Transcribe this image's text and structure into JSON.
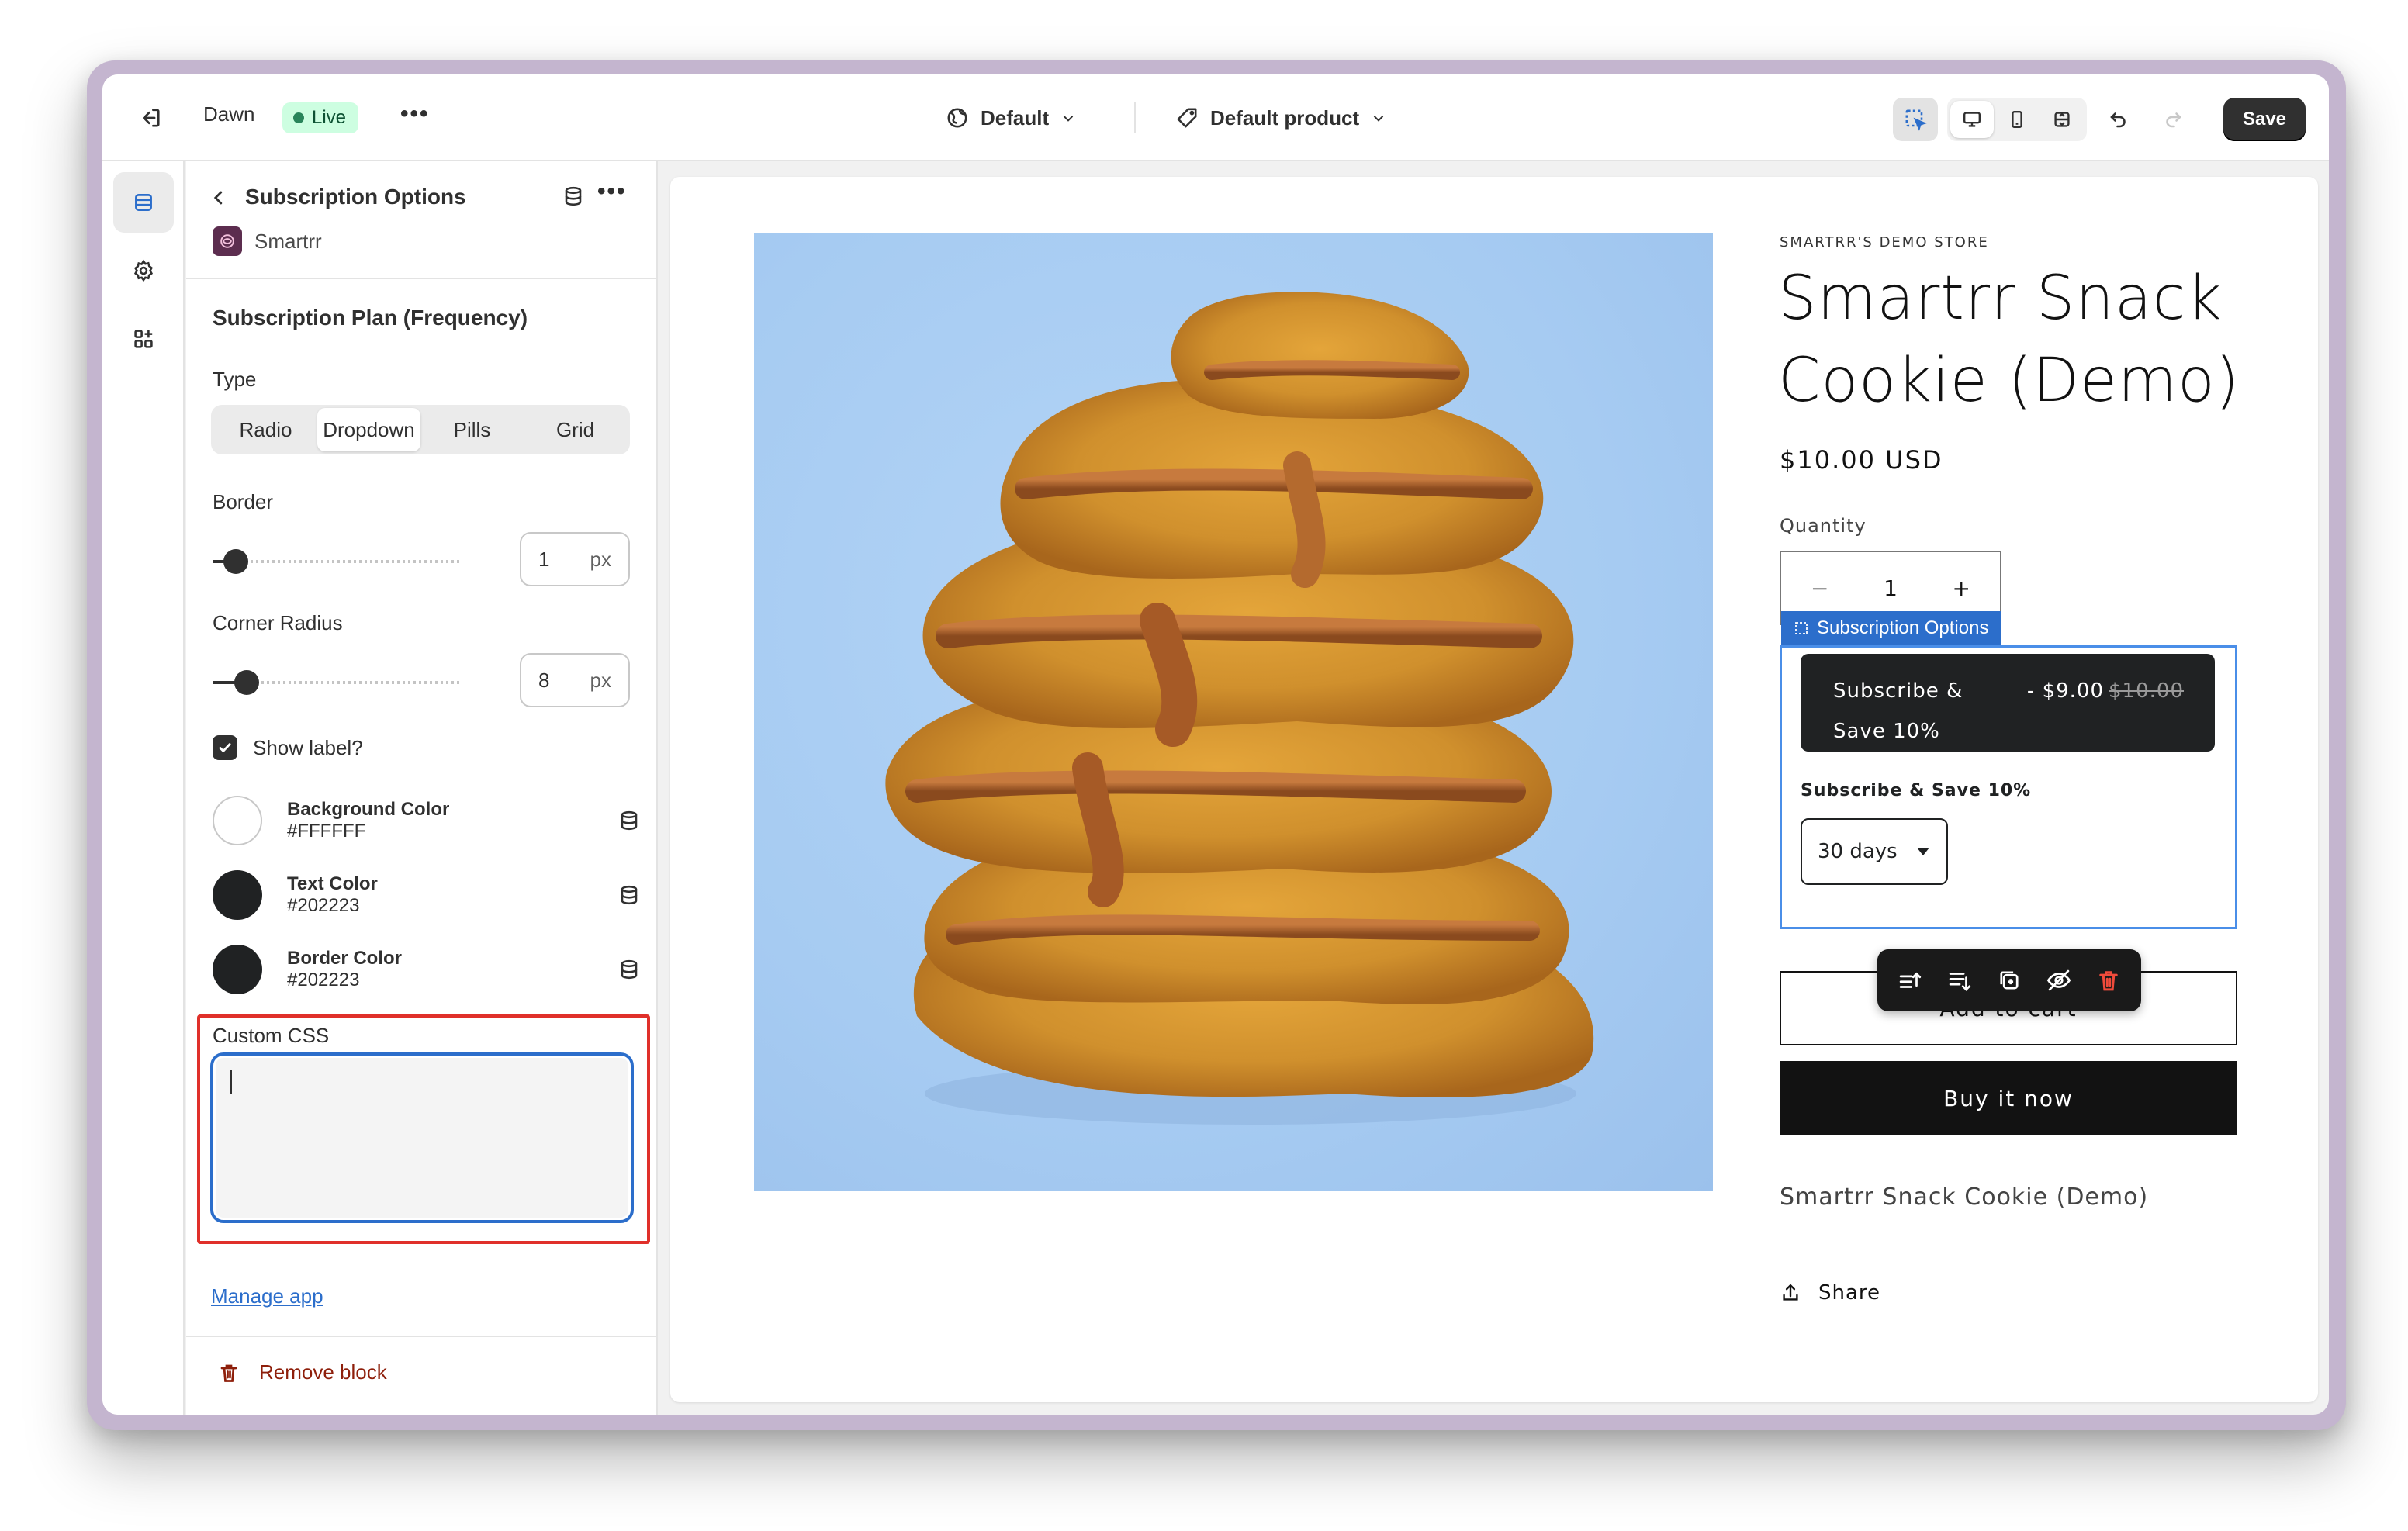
{
  "topbar": {
    "theme_name": "Dawn",
    "status_badge": "Live",
    "template_default": "Default",
    "template_product": "Default product",
    "save_label": "Save"
  },
  "panel": {
    "title": "Subscription Options",
    "app_name": "Smartrr",
    "section_title": "Subscription Plan (Frequency)",
    "type_label": "Type",
    "type_options": [
      "Radio",
      "Dropdown",
      "Pills",
      "Grid"
    ],
    "type_selected": "Dropdown",
    "border_label": "Border",
    "border_value": "1",
    "border_unit": "px",
    "radius_label": "Corner Radius",
    "radius_value": "8",
    "radius_unit": "px",
    "show_label_text": "Show label?",
    "show_label_checked": true,
    "colors": [
      {
        "name": "Background Color",
        "hex": "#FFFFFF"
      },
      {
        "name": "Text Color",
        "hex": "#202223"
      },
      {
        "name": "Border Color",
        "hex": "#202223"
      }
    ],
    "custom_css_label": "Custom CSS",
    "custom_css_value": "",
    "manage_app_link": "Manage app",
    "remove_block_label": "Remove block"
  },
  "preview": {
    "store_name": "SMARTRR'S DEMO STORE",
    "product_title": "Smartrr Snack Cookie (Demo)",
    "price": "$10.00 USD",
    "quantity_label": "Quantity",
    "quantity_value": "1",
    "selected_block_tag": "Subscription Options",
    "subscription_plan_name": "Subscribe & Save 10%",
    "subscription_price": "- $9.00",
    "subscription_compare_price": "$10.00",
    "subscription_section_label": "Subscribe & Save 10%",
    "frequency_value": "30 days",
    "add_to_cart_label": "Add to cart",
    "buy_now_label": "Buy it now",
    "description": "Smartrr Snack Cookie (Demo)",
    "share_label": "Share"
  },
  "colors": {
    "accent_blue": "#2c6ecb",
    "live_green": "#29845a",
    "highlight_red": "#e0302a",
    "critical": "#8e1f0b",
    "dark": "#202223"
  }
}
